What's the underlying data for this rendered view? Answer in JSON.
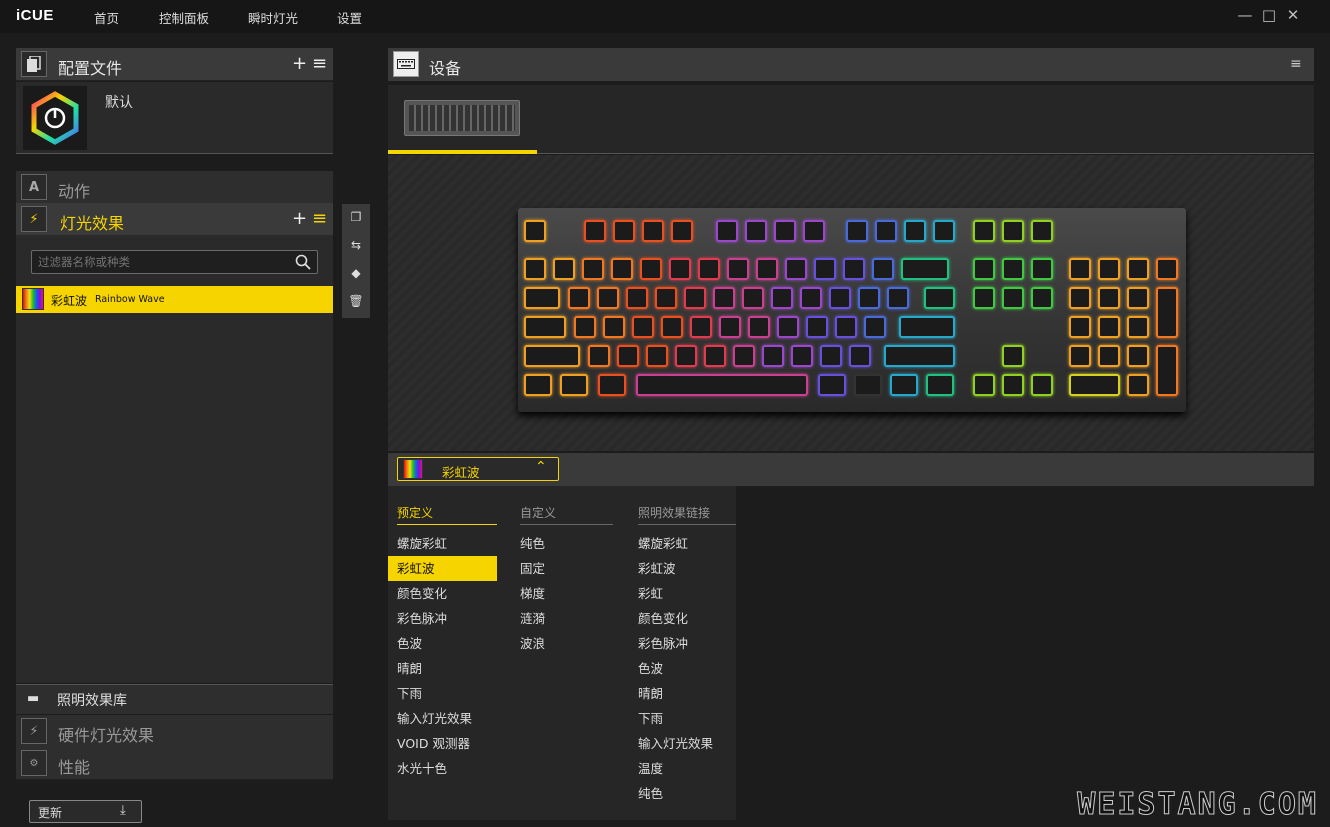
{
  "titlebar": {
    "logo": "iCUE",
    "nav": [
      "首页",
      "控制面板",
      "瞬时灯光",
      "设置"
    ],
    "minimize": "—",
    "maximize": "□",
    "close": "✕"
  },
  "profiles": {
    "title": "配置文件",
    "add": "+",
    "menu": "≡",
    "default_profile": "默认"
  },
  "actions": {
    "title": "动作"
  },
  "lighting": {
    "title": "灯光效果",
    "add": "+",
    "menu": "≡",
    "search_placeholder": "过滤器名称或种类",
    "effect": {
      "name": "彩虹波",
      "type": "Rainbow Wave"
    }
  },
  "library": {
    "title": "照明效果库"
  },
  "hardware": {
    "title": "硬件灯光效果"
  },
  "performance": {
    "title": "性能"
  },
  "update": {
    "label": "更新"
  },
  "device": {
    "title": "设备"
  },
  "effect_select": {
    "value": "彩虹波"
  },
  "effect_menu": {
    "columns": [
      {
        "header": "预定义",
        "items": [
          "螺旋彩虹",
          "彩虹波",
          "颜色变化",
          "彩色脉冲",
          "色波",
          "晴朗",
          "下雨",
          "输入灯光效果",
          "VOID 观测器",
          "水光十色"
        ],
        "selected": 1
      },
      {
        "header": "自定义",
        "items": [
          "纯色",
          "固定",
          "梯度",
          "涟漪",
          "波浪"
        ]
      },
      {
        "header": "照明效果链接",
        "items": [
          "螺旋彩虹",
          "彩虹波",
          "彩虹",
          "颜色变化",
          "彩色脉冲",
          "色波",
          "晴朗",
          "下雨",
          "输入灯光效果",
          "温度",
          "纯色"
        ]
      }
    ]
  },
  "watermark": "WEISTANG.COM",
  "colors": {
    "accent": "#f5d400",
    "bg": "#1c1c1c",
    "panel": "#3a3a3a"
  }
}
